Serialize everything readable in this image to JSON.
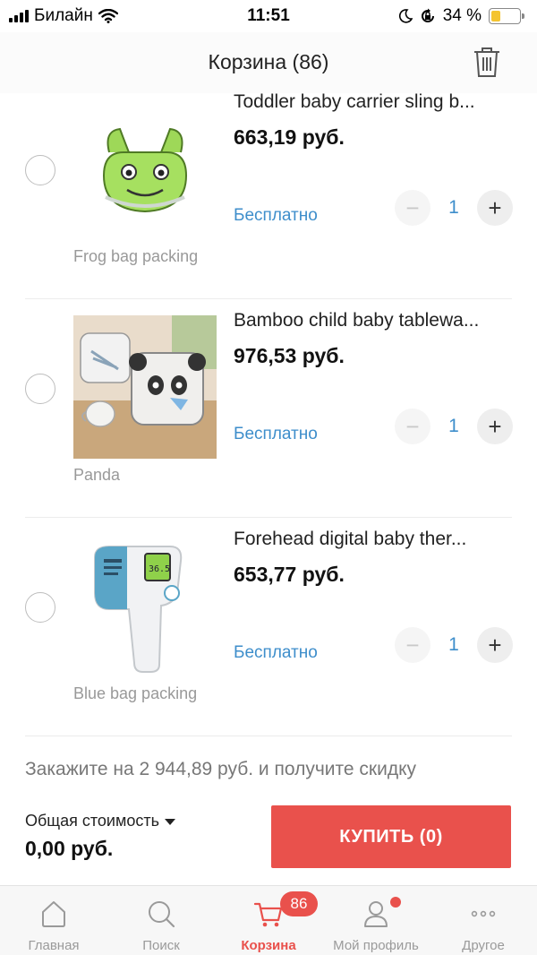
{
  "status_bar": {
    "carrier": "Билайн",
    "time": "11:51",
    "battery_percent": "34 %",
    "battery_level": 0.34,
    "icons": [
      "signal-icon",
      "wifi-icon",
      "moon-icon",
      "rotation-lock-icon",
      "battery-icon"
    ]
  },
  "header": {
    "title": "Корзина (86)",
    "trash_icon": "trash-icon"
  },
  "cart": {
    "items": [
      {
        "name": "Toddler baby carrier sling b...",
        "price": "663,19 руб.",
        "shipping": "Бесплатно",
        "variant": "Frog bag packing",
        "quantity": "1",
        "minus": "−",
        "plus": "+",
        "thumbnail": "frog-carrier-image"
      },
      {
        "name": "Bamboo child baby tablewa...",
        "price": "976,53 руб.",
        "shipping": "Бесплатно",
        "variant": "Panda",
        "quantity": "1",
        "minus": "−",
        "plus": "+",
        "thumbnail": "panda-tableware-image"
      },
      {
        "name": "Forehead digital baby ther...",
        "price": "653,77 руб.",
        "shipping": "Бесплатно",
        "variant": "Blue bag packing",
        "quantity": "1",
        "minus": "−",
        "plus": "+",
        "thumbnail": "thermometer-image"
      }
    ],
    "promo": "Закажите на 2 944,89 руб. и получите скидку"
  },
  "checkout": {
    "total_label": "Общая стоимость",
    "total_value": "0,00 руб.",
    "buy_label": "КУПИТЬ (0)",
    "accent_color": "#e9514c"
  },
  "tabbar": {
    "tabs": [
      {
        "label": "Главная",
        "icon": "home-icon"
      },
      {
        "label": "Поиск",
        "icon": "search-icon"
      },
      {
        "label": "Корзина",
        "icon": "cart-icon",
        "badge": "86",
        "active": true
      },
      {
        "label": "Мой профиль",
        "icon": "profile-icon",
        "dot": true
      },
      {
        "label": "Другое",
        "icon": "more-icon"
      }
    ]
  }
}
